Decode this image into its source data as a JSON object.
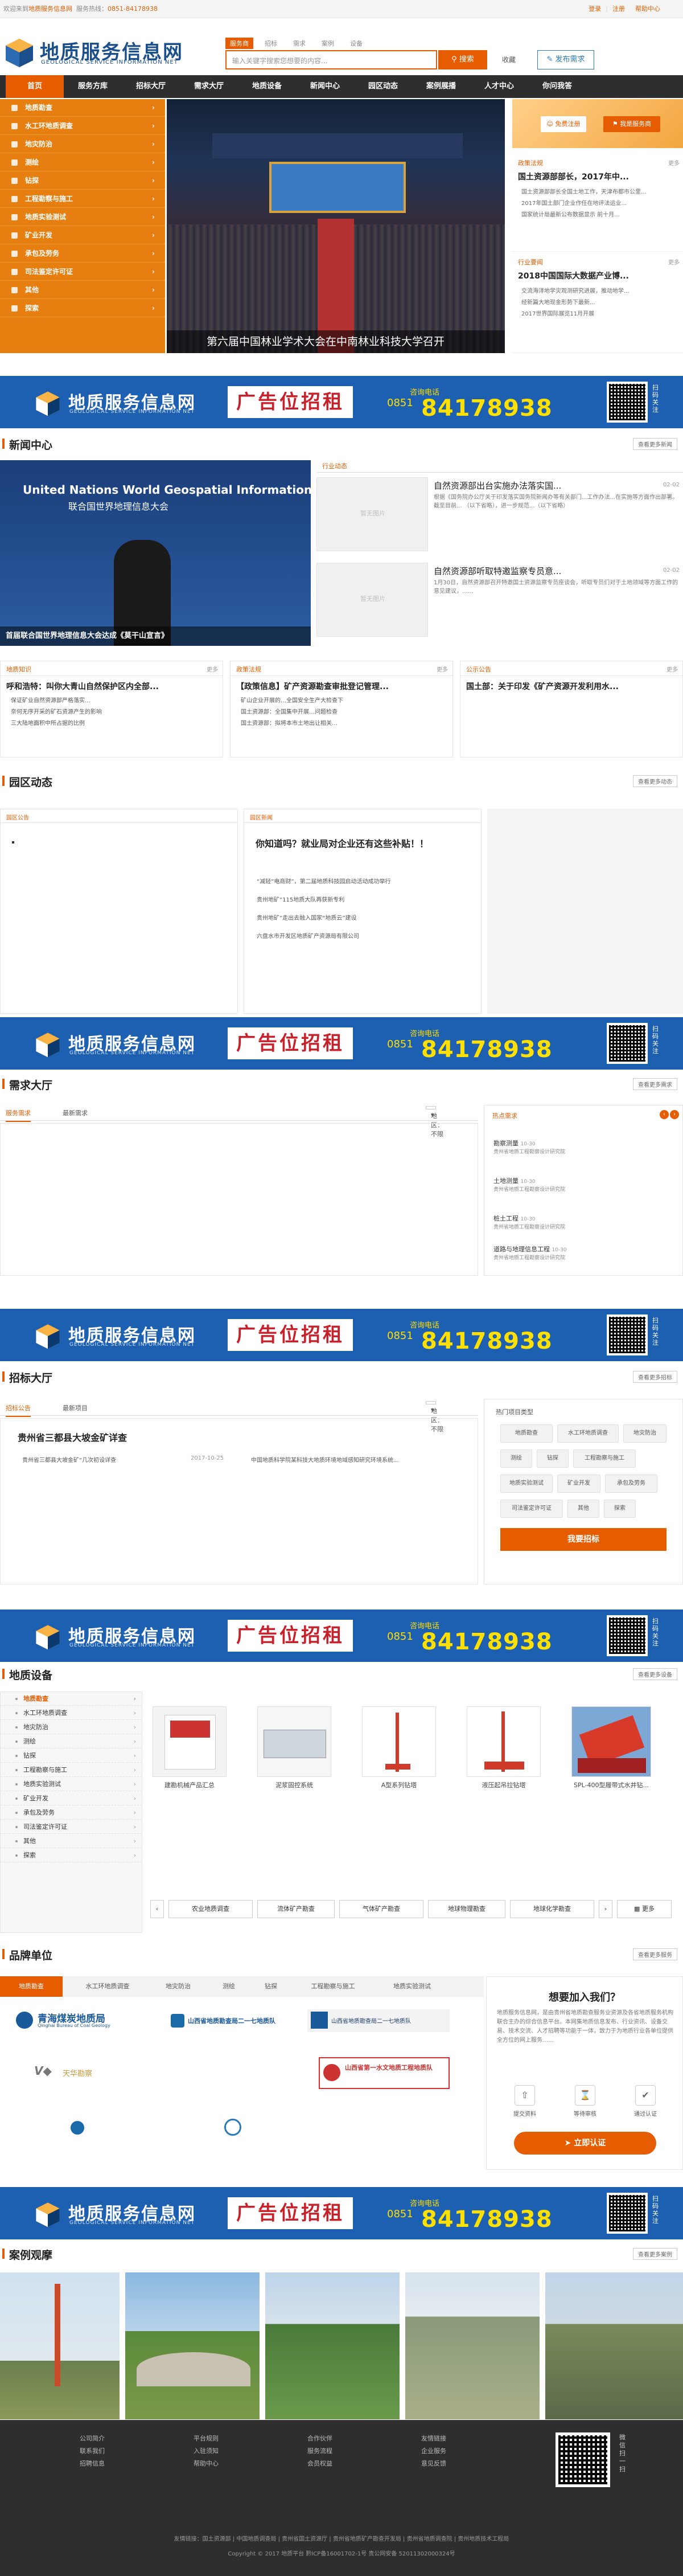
{
  "topbar": {
    "welcome": "欢迎来到",
    "site": "地质服务信息网",
    "hotline_label": "服务热线：",
    "hotline": "0851-84178938",
    "login": "登录",
    "sep": "|",
    "register": "注册",
    "help": "帮助中心"
  },
  "header": {
    "logo_cn": "地质服务信息网",
    "logo_en": "GEOLOGICAL SERVICE INFORMATION NET",
    "search_tabs": [
      "服务商",
      "招标",
      "需求",
      "案例",
      "设备"
    ],
    "search_placeholder": "输入关键字搜索您想要的内容...",
    "search_button": "搜索",
    "favorite": "收藏",
    "publish": "发布需求"
  },
  "nav": [
    "首页",
    "服务方库",
    "招标大厅",
    "需求大厅",
    "地质设备",
    "新闻中心",
    "园区动态",
    "案例展播",
    "人才中心",
    "你问我答"
  ],
  "left_menu": [
    "地质勘查",
    "水工环地质调查",
    "地灾防治",
    "测绘",
    "钻探",
    "工程勘察与施工",
    "地质实验测试",
    "矿业开发",
    "承包及劳务",
    "司法鉴定许可证",
    "其他",
    "探索"
  ],
  "hero": {
    "caption": "第六届中国林业学术大会在中南林业科技大学召开"
  },
  "right_col": {
    "btn1": "免费注册",
    "btn2": "我是服务商",
    "sec1_title": "政策法规",
    "sec1_more": "更多",
    "sec1_head": "国土资源部部长，2017年中...",
    "sec1_lines": [
      "国土资源部部长全国土地工作，天津布都市公里...",
      "2017年国土部门企业作任在地评法运业...",
      "国家统计局最新公布数据显示 前十月..."
    ],
    "sec2_title": "行业要闻",
    "sec2_more": "更多",
    "sec2_head": "2018中国国际大数据产业博...",
    "sec2_lines": [
      "交流海洋地学灾观测研究进展，推动地学...",
      "经新篇大地现金形势下最新...",
      "2017世界国际展览11月开展"
    ]
  },
  "ads": {
    "logo_cn": "地质服务信息网",
    "logo_en": "GEOLOGICAL SERVICE INFORMATION NET",
    "slogan": "广告位招租",
    "tel_label": "咨询电话",
    "area": "0851",
    "tel": "84178938",
    "qr_label": "扫码关注"
  },
  "news": {
    "title": "新闻中心",
    "more": "查看更多新闻",
    "img_title": "United Nations World Geospatial Information Congress",
    "img_sub": "联合国世界地理信息大会",
    "img_caption": "首届联合国世界地理信息大会达成《莫干山宣言》",
    "tab": "行业动态",
    "items": [
      {
        "title": "自然资源部出台实施办法落实国...",
        "date": "02-02",
        "desc": "根据《国务院办公厅关于印发落实国务院新闻办等有关部门...工作办法...在实施等方面作出部署。截至目前... （以下省略），进一步规范...（以下省略）"
      },
      {
        "title": "自然资源部听取特邀监察专员意...",
        "date": "02-02",
        "desc": "1月30日，自然资源部召开特邀国土资源监察专员座谈会，听取专员们对于土地领域等方面工作的意见建议，……"
      }
    ],
    "no_image": "暂无图片",
    "boxes": [
      {
        "tab": "地质知识",
        "more": "更多",
        "head": "呼和浩特：叫你大青山自然保护区内全部...",
        "lines": [
          "保证矿业自然资源部严格落实…",
          "奈何无序开采的矿石资源产生的影响",
          "三大陆地面积中所占据的比例"
        ]
      },
      {
        "tab": "政策法规",
        "more": "更多",
        "head": "【政策信息】矿产资源勘查审批登记管理...",
        "lines": [
          "矿山企业开展的…全国安全生产大检查下",
          "国土资源部：全国集中开展…问题检查",
          "国土资源部：拟将本市土地出让相关…"
        ]
      },
      {
        "tab": "公示公告",
        "more": "更多",
        "head": "国土部：关于印发《矿产资源开发利用水...",
        "lines": []
      }
    ]
  },
  "park": {
    "title": "园区动态",
    "more": "查看更多动态",
    "box1_tab": "园区公告",
    "box2_tab": "园区新闻",
    "box2_head": "你知道吗？就业局对企业还有这些补贴！！",
    "box2_lines": [
      "“减轻”电商财”，第二届地质科技园启动活动成功举行",
      "贵州地矿“115地质大队再获新专利",
      "贵州地矿“走出去融入国家“地质云”建设",
      "六盘水市开发区地质矿产资源局有限公司"
    ]
  },
  "demand": {
    "title": "需求大厅",
    "more": "查看更多需求",
    "tabs": [
      "服务需求",
      "最新需求"
    ],
    "region": "地区：不限",
    "hot_title": "热点需求",
    "hot": [
      {
        "name": "勘察测量",
        "date": "10-30",
        "sub": "贵州省地质工程勘察设计研究院"
      },
      {
        "name": "土地测量",
        "date": "10-30",
        "sub": "贵州省地质工程勘察设计研究院"
      },
      {
        "name": "桩土工程",
        "date": "10-30",
        "sub": "贵州省地质工程勘察设计研究院"
      },
      {
        "name": "道路与地理信息工程",
        "date": "10-30",
        "sub": "贵州省地质工程勘察设计研究院"
      }
    ]
  },
  "tender": {
    "title": "招标大厅",
    "more": "查看更多招标",
    "tabs": [
      "招标公告",
      "最新项目"
    ],
    "region": "地区：不限",
    "head": "贵州省三都县大坡金矿详查",
    "lines": [
      {
        "t": "贵州省三都县大坡金矿“几次初设详查",
        "d": "2017-10-25"
      },
      {
        "t": "中国地质科学院某科技大地质环境地域感知研究环境系统...",
        "d": ""
      }
    ],
    "types_title": "热门项目类型",
    "types": [
      "地质勘查",
      "水工环地质调查",
      "地灾防治",
      "测绘",
      "钻探",
      "工程勘察与施工",
      "地质实验测试",
      "矿业开发",
      "承包及劳务",
      "司法鉴定许可证",
      "其他",
      "探索"
    ],
    "cta": "我要招标"
  },
  "equip": {
    "title": "地质设备",
    "more": "查看更多设备",
    "side": [
      "地质勘查",
      "水工环地质调查",
      "地灾防治",
      "测绘",
      "钻探",
      "工程勘察与施工",
      "地质实验测试",
      "矿业开发",
      "承包及劳务",
      "司法鉴定许可证",
      "其他",
      "探索"
    ],
    "products": [
      "建勘机械产品汇总",
      "泥浆固控系统",
      "A型系列钻塔",
      "液压起吊拉钻塔",
      "SPL-400型履带式水井钻..."
    ],
    "cats": [
      "农业地质调查",
      "流体矿产勘查",
      "气体矿产勘查",
      "地球物理勘查",
      "地球化学勘查"
    ],
    "more_btn": "更多"
  },
  "brand": {
    "title": "品牌单位",
    "more": "查看更多服务",
    "tabs": [
      "地质勘查",
      "水工环地质调查",
      "地灾防治",
      "测绘",
      "钻探",
      "工程勘察与施工",
      "地质实验测试"
    ],
    "logos": [
      {
        "cn": "青海煤炭地质局",
        "en": "Qinghai Bureau of Coal Geology"
      },
      {
        "cn": "山西省地质勘查局二一七地质队",
        "en": ""
      },
      {
        "cn": "山西省地质勘查局二一七地质队",
        "en": ""
      },
      {
        "cn": "天华勘察",
        "en": ""
      },
      {
        "cn": "",
        "en": ""
      },
      {
        "cn": "山西省第一水文地质工程地质队",
        "en": ""
      }
    ],
    "join_title": "想要加入我们？",
    "join_text": "地质服务信息网，是由贵州省地质勘查服务业资源及各省地质服务机构联合主办的综合信息平台。本网集地质信息发布、行业资讯、设备交易、技术交流、人才招聘等功能于一体，致力于为地质行业各单位提供全方位的网上服务……",
    "icons": [
      "提交资料",
      "等待审核",
      "通过认证"
    ],
    "join_btn": "立即认证"
  },
  "cases": {
    "title": "案例观摩",
    "more": "查看更多案例"
  },
  "footer": {
    "cols": [
      [
        "公司简介",
        "联系我们",
        "招聘信息"
      ],
      [
        "平台规则",
        "入驻须知",
        "帮助中心"
      ],
      [
        "合作伙伴",
        "服务流程",
        "会员权益"
      ],
      [
        "友情链接",
        "企业服务",
        "意见反馈"
      ]
    ],
    "qr_label": "微信扫一扫",
    "links": "友情链接：国土资源部 | 中国地质调查局 | 贵州省国土资源厅 | 贵州省地质矿产勘查开发局 | 贵州省地质调查院 | 贵州地质技术工程局",
    "copy": "Copyright © 2017 地质平台 黔ICP备16001702-1号 贵公网安备 52011302000324号"
  }
}
